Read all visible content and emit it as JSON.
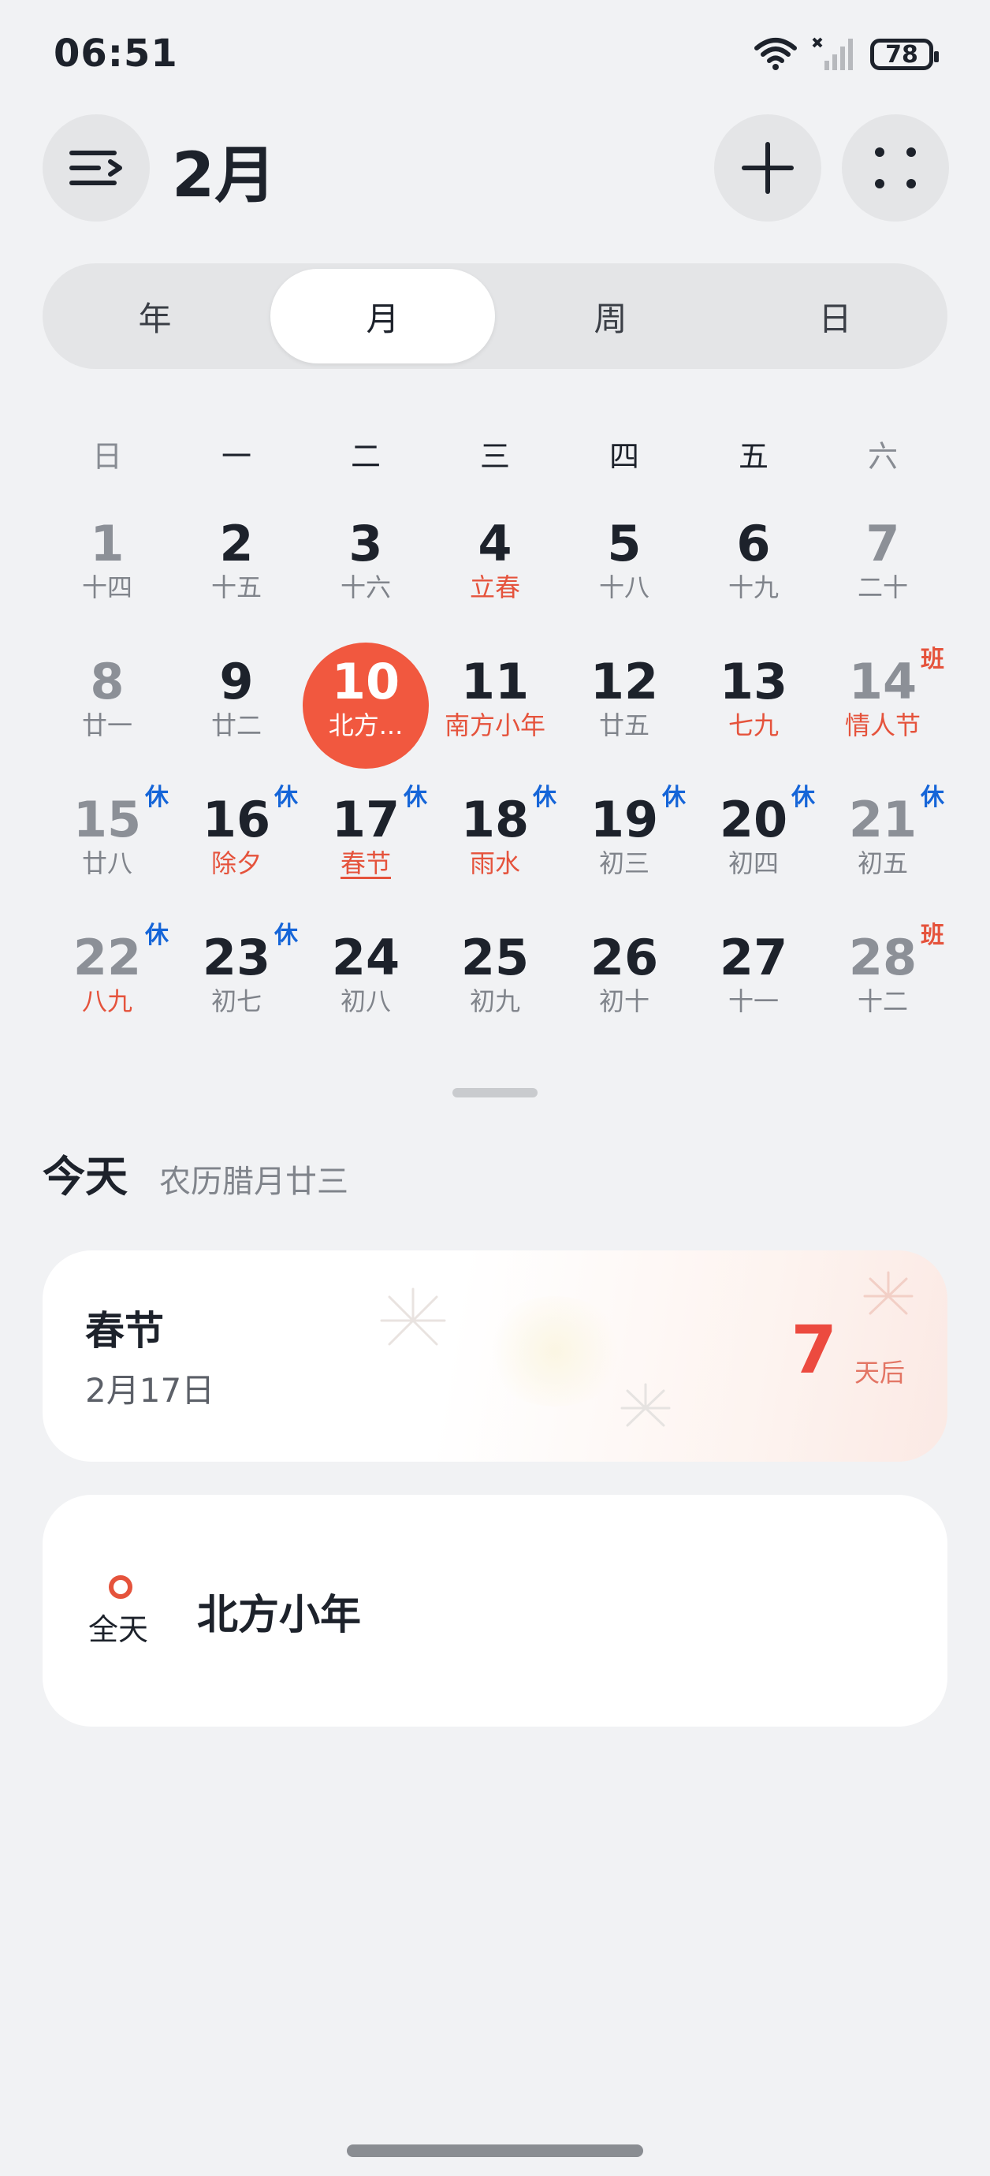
{
  "status_bar": {
    "time": "06:51",
    "battery": "78"
  },
  "header": {
    "month_title": "2月"
  },
  "view_tabs": [
    {
      "label": "年",
      "active": false
    },
    {
      "label": "月",
      "active": true
    },
    {
      "label": "周",
      "active": false
    },
    {
      "label": "日",
      "active": false
    }
  ],
  "weekdays": [
    "日",
    "一",
    "二",
    "三",
    "四",
    "五",
    "六"
  ],
  "calendar": {
    "weeks": [
      [
        {
          "day": "1",
          "lunar": "十四"
        },
        {
          "day": "2",
          "lunar": "十五"
        },
        {
          "day": "3",
          "lunar": "十六"
        },
        {
          "day": "4",
          "lunar": "立春",
          "lunar_red": true
        },
        {
          "day": "5",
          "lunar": "十八"
        },
        {
          "day": "6",
          "lunar": "十九"
        },
        {
          "day": "7",
          "lunar": "二十"
        }
      ],
      [
        {
          "day": "8",
          "lunar": "廿一"
        },
        {
          "day": "9",
          "lunar": "廿二"
        },
        {
          "day": "10",
          "lunar": "北方...",
          "today": true
        },
        {
          "day": "11",
          "lunar": "南方小年",
          "lunar_red": true
        },
        {
          "day": "12",
          "lunar": "廿五"
        },
        {
          "day": "13",
          "lunar": "七九",
          "lunar_red": true
        },
        {
          "day": "14",
          "lunar": "情人节",
          "lunar_red": true,
          "badge": "班",
          "badge_type": "work"
        }
      ],
      [
        {
          "day": "15",
          "lunar": "廿八",
          "badge": "休",
          "badge_type": "rest"
        },
        {
          "day": "16",
          "lunar": "除夕",
          "lunar_red": true,
          "badge": "休",
          "badge_type": "rest"
        },
        {
          "day": "17",
          "lunar": "春节",
          "lunar_red": true,
          "underline": true,
          "badge": "休",
          "badge_type": "rest"
        },
        {
          "day": "18",
          "lunar": "雨水",
          "lunar_red": true,
          "badge": "休",
          "badge_type": "rest"
        },
        {
          "day": "19",
          "lunar": "初三",
          "badge": "休",
          "badge_type": "rest"
        },
        {
          "day": "20",
          "lunar": "初四",
          "badge": "休",
          "badge_type": "rest"
        },
        {
          "day": "21",
          "lunar": "初五",
          "badge": "休",
          "badge_type": "rest"
        }
      ],
      [
        {
          "day": "22",
          "lunar": "八九",
          "lunar_red": true,
          "badge": "休",
          "badge_type": "rest"
        },
        {
          "day": "23",
          "lunar": "初七",
          "badge": "休",
          "badge_type": "rest"
        },
        {
          "day": "24",
          "lunar": "初八"
        },
        {
          "day": "25",
          "lunar": "初九"
        },
        {
          "day": "26",
          "lunar": "初十"
        },
        {
          "day": "27",
          "lunar": "十一"
        },
        {
          "day": "28",
          "lunar": "十二",
          "badge": "班",
          "badge_type": "work"
        }
      ]
    ]
  },
  "today_section": {
    "label": "今天",
    "lunar_date": "农历腊月廿三",
    "festival_card": {
      "title": "春节",
      "date": "2月17日",
      "countdown": "7",
      "countdown_unit": "天后"
    },
    "event_card": {
      "all_day": "全天",
      "title": "北方小年"
    }
  },
  "colors": {
    "accent_red": "#f1583f",
    "rest_blue": "#1565d8",
    "background": "#f1f2f4"
  }
}
